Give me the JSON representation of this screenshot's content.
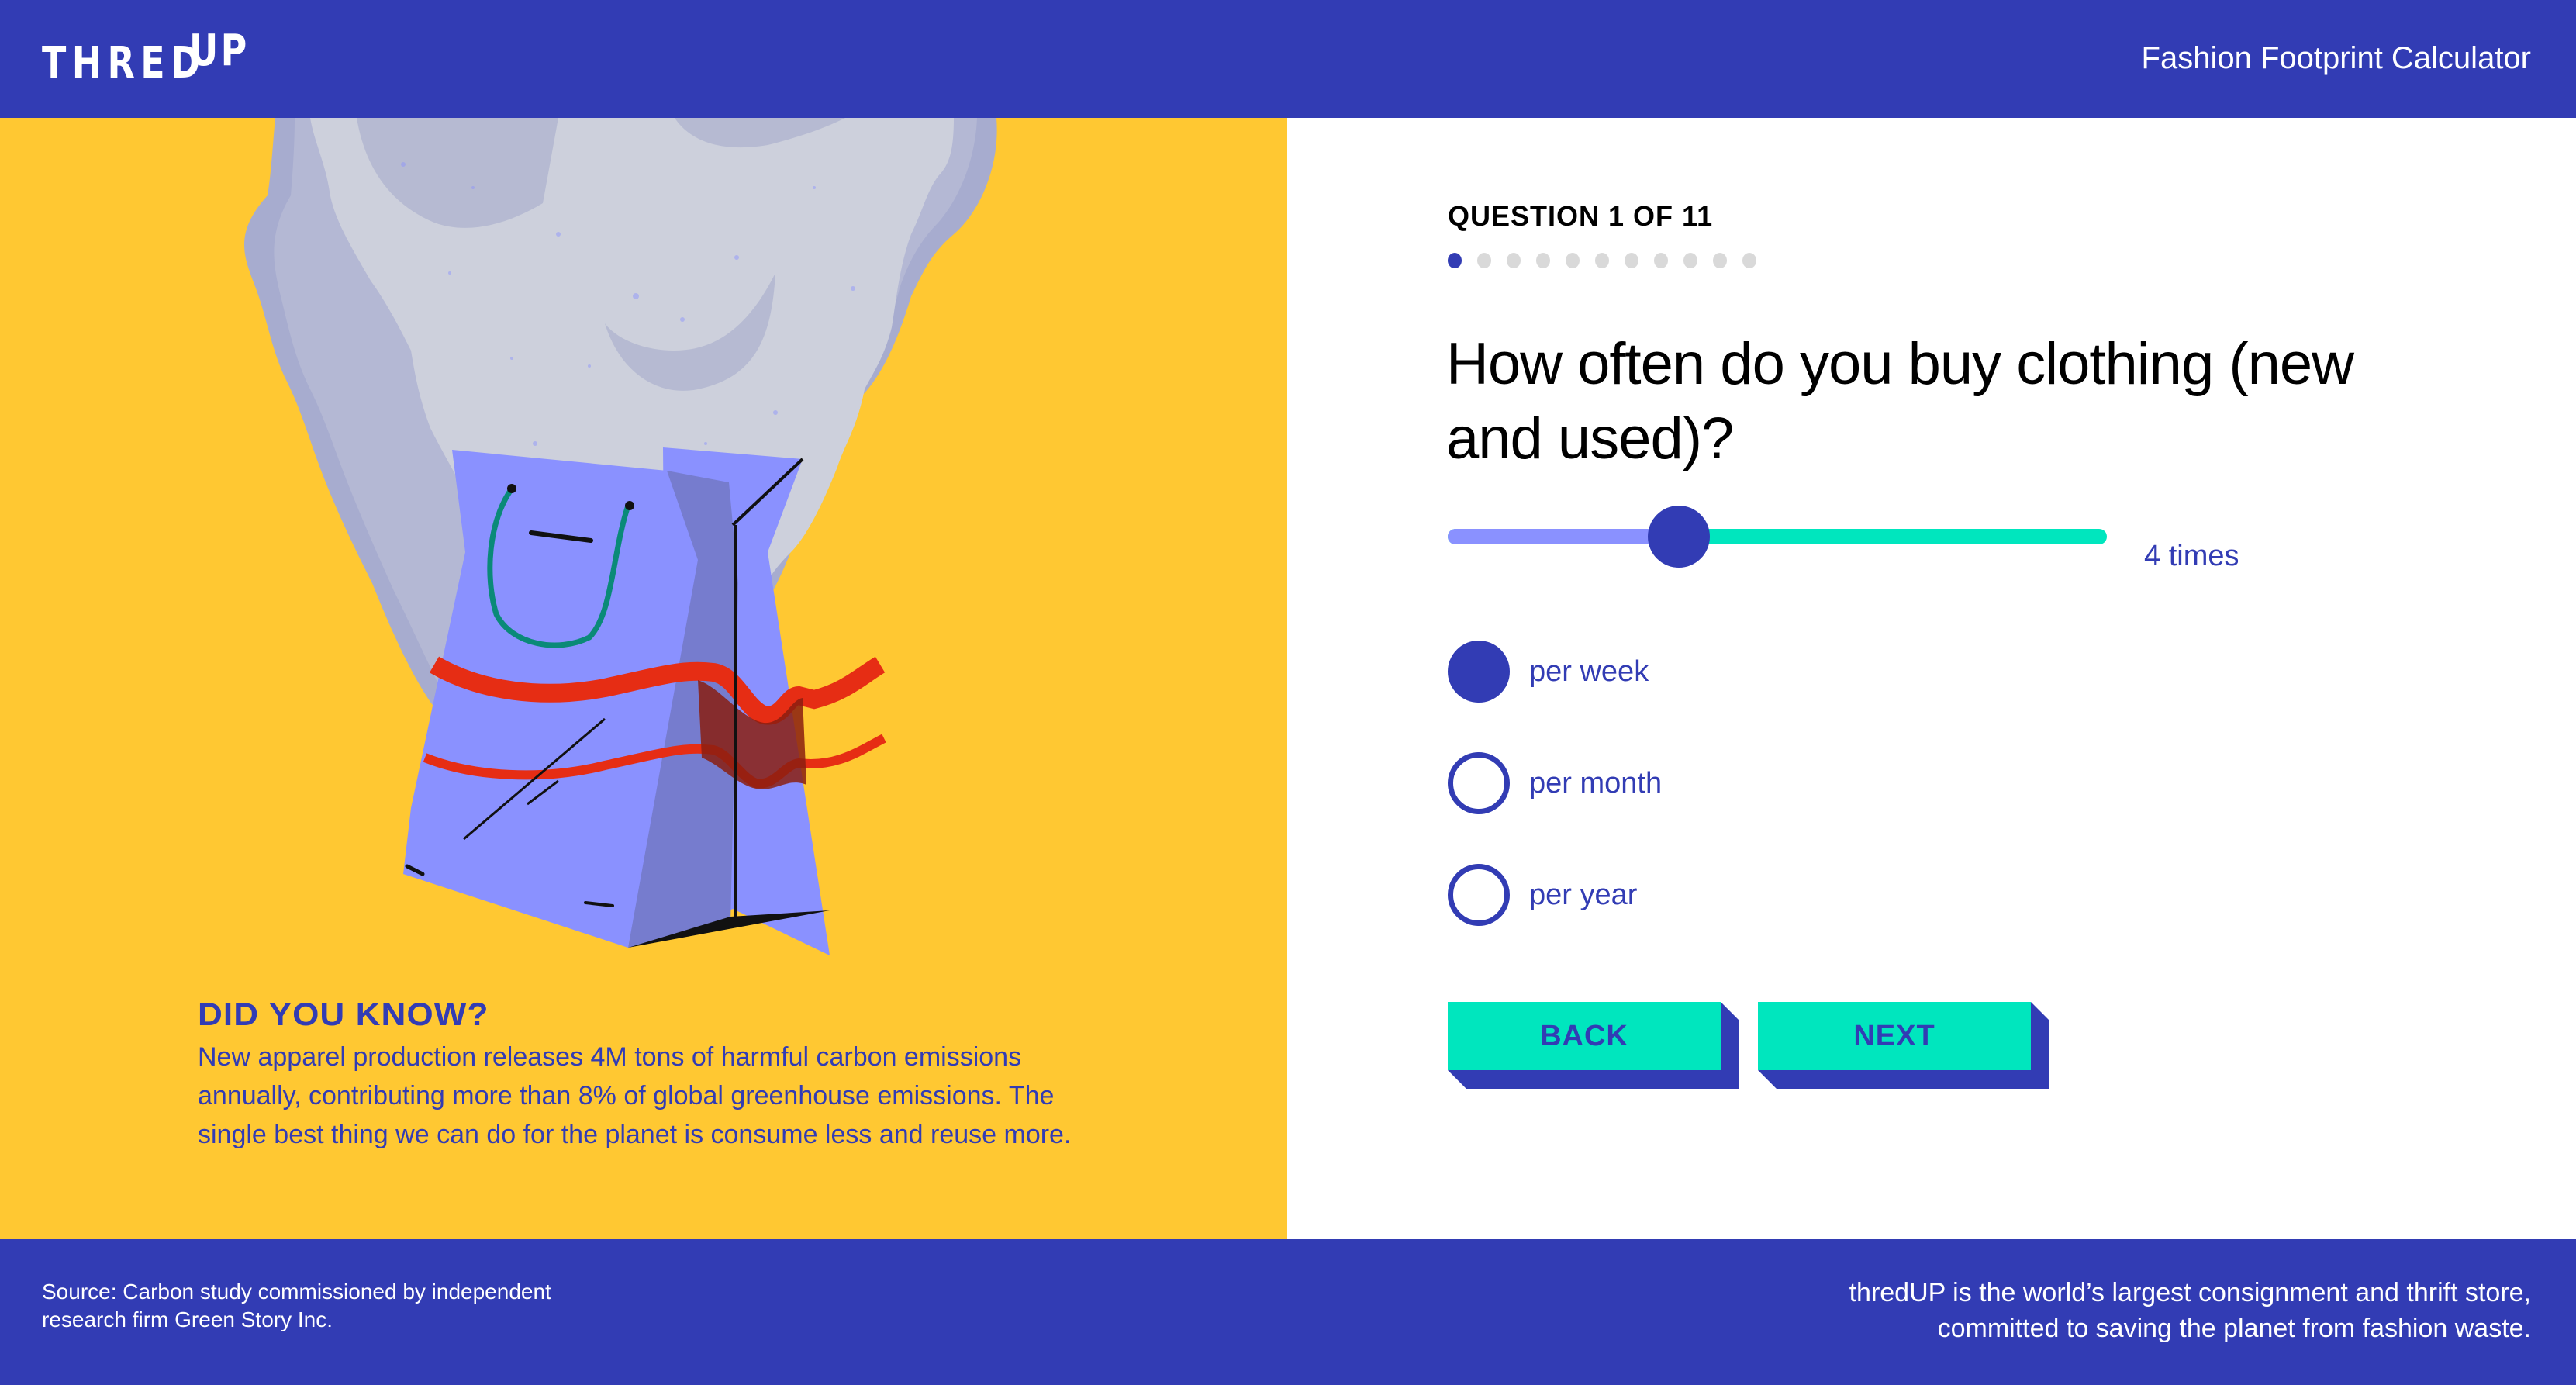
{
  "header": {
    "logo_main": "THRED",
    "logo_superscript": "UP",
    "title": "Fashion Footprint Calculator"
  },
  "illustration": {
    "subject": "shopping-bag-emitting-smoke"
  },
  "fact": {
    "title": "DID YOU KNOW?",
    "body": "New apparel production releases 4M tons of harmful carbon emissions annually, contributing more than 8% of global greenhouse emissions. The single best thing we can do for the planet is consume less and reuse more."
  },
  "question": {
    "counter": "QUESTION 1 OF 11",
    "current": 1,
    "total": 11,
    "title": "How often do you buy clothing (new and used)?",
    "slider": {
      "value_label": "4 times",
      "fill_fraction": 0.35
    },
    "options": [
      {
        "label": "per week",
        "selected": true
      },
      {
        "label": "per month",
        "selected": false
      },
      {
        "label": "per year",
        "selected": false
      }
    ],
    "back_label": "BACK",
    "next_label": "NEXT"
  },
  "footer": {
    "source": "Source: Carbon study commissioned by independent research firm Green Story Inc.",
    "about_line1": "thredUP is the world’s largest consignment and thrift store,",
    "about_line2": "committed to saving the planet from fashion waste."
  },
  "colors": {
    "brand_blue": "#323CB4",
    "accent_yellow": "#FFC832",
    "accent_teal": "#00E6BE",
    "slider_fill": "#8A91FF",
    "dot_inactive": "#D9D9D9"
  }
}
